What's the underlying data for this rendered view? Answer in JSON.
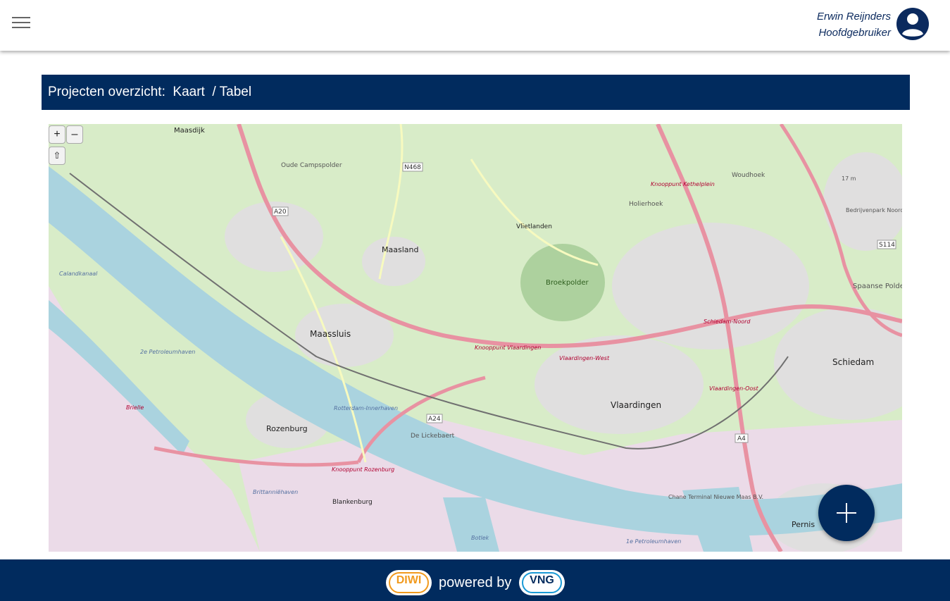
{
  "header": {
    "user_name": "Erwin Reijnders",
    "user_role": "Hoofdgebruiker",
    "menu_icon": "hamburger-menu-icon",
    "avatar_icon": "account-circle-icon"
  },
  "banner": {
    "title": "Projecten overzicht:",
    "kaart_link": "Kaart",
    "separator": "/",
    "tabel_link": "Tabel"
  },
  "map": {
    "zoom_in": "+",
    "zoom_out": "–",
    "reset": "⇧",
    "place_labels": {
      "maassluis": "Maassluis",
      "maasland": "Maasland",
      "vlaardingen": "Vlaardingen",
      "schiedam": "Schiedam",
      "rozenburg": "Rozenburg",
      "pernis": "Pernis",
      "maasdijk": "Maasdijk",
      "broekpolder": "Broekpolder",
      "vlietlanden": "Vlietlanden",
      "blankenburg": "Blankenburg",
      "spaanse_polder": "Spaanse Polder",
      "oude_campspolder": "Oude Campspolder",
      "holierhoek": "Holierhoek",
      "woudhoek": "Woudhoek",
      "de_lickebaert": "De Lickebaert",
      "chane_terminal": "Chane Terminal Nieuwe Maas B.V.",
      "a20": "A20",
      "a24": "A24",
      "a4": "A4",
      "n468": "N468",
      "s114": "S114",
      "knooppunt_kethelplein": "Knooppunt Kethelplein",
      "knooppunt_vlaardingen": "Knooppunt Vlaardingen",
      "knooppunt_rozenburg": "Knooppunt Rozenburg",
      "rotterdam_inn": "Rotterdam-Innerhaven",
      "vlaardingen_west": "Vlaardingen-West",
      "vlaardingen_oost": "Vlaardingen-Oost",
      "schiedam_noord": "Schiedam-Noord",
      "brielle": "Brielle",
      "petroleumhaven": "2e Petroleumhaven",
      "petroleumhaven_1": "1e Petroleumhaven",
      "britanniehaven": "Brittanniëhaven",
      "botlek": "Botlek",
      "calandkanaal": "Calandkanaal",
      "bedrijvenpark": "Bedrijvenpark Noord West",
      "height": "17 m"
    }
  },
  "fab": {
    "icon": "plus-icon"
  },
  "footer": {
    "diwi_logo": "DIWI",
    "powered_by": "powered by",
    "vng_logo": "VNG"
  },
  "colors": {
    "navy": "#012b5e",
    "water": "#aad3df",
    "land": "#d8ecc8",
    "urban": "#e0dfdf",
    "industrial": "#ebdbe8",
    "motorway": "#e892a2"
  }
}
